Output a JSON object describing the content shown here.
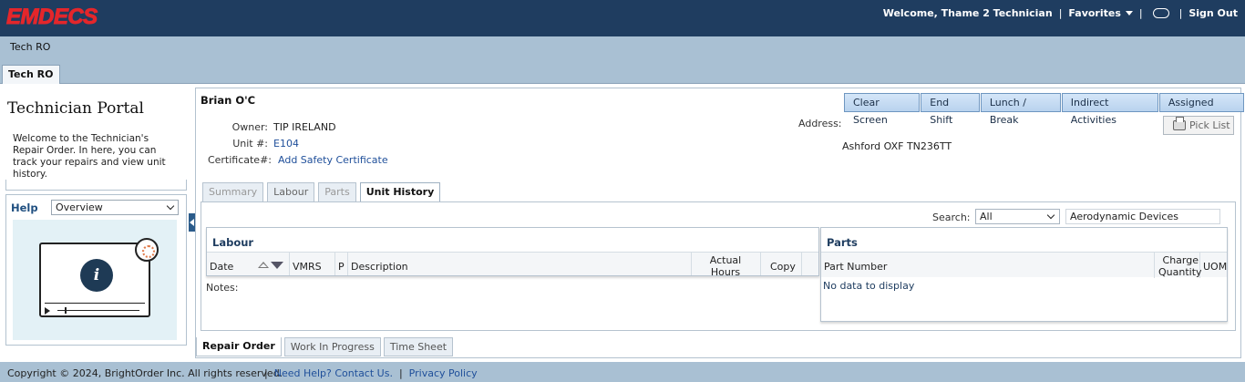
{
  "header": {
    "logo": "EMDECS",
    "welcome": "Welcome, Thame 2 Technician",
    "favorites": "Favorites",
    "sign_out": "Sign Out",
    "separator": "|"
  },
  "breadcrumb": "Tech RO",
  "top_tab": "Tech RO",
  "left": {
    "title": "Technician Portal",
    "description": "Welcome to the Technician's Repair Order. In here, you can track your repairs and view unit history.",
    "help_label": "Help",
    "help_select_value": "Overview"
  },
  "tech": {
    "name": "Brian O'C",
    "owner_label": "Owner:",
    "owner_value": "TIP IRELAND",
    "unit_label": "Unit #:",
    "unit_value": "E104",
    "cert_label": "Certificate#:",
    "cert_value": "Add Safety Certificate",
    "address_label": "Address:",
    "address_value": "Ashford OXF TN236TT"
  },
  "actions": {
    "clear_screen": "Clear Screen",
    "end_shift": "End Shift",
    "lunch_break": "Lunch / Break",
    "indirect": "Indirect Activities",
    "assigned": "Assigned Work",
    "pick_list": "Pick List"
  },
  "tabs": [
    "Summary",
    "Labour",
    "Parts",
    "Unit History"
  ],
  "search": {
    "label": "Search:",
    "select_value": "All",
    "input_value": "Aerodynamic Devices"
  },
  "labour": {
    "title": "Labour",
    "columns": [
      "Date",
      "VMRS",
      "P",
      "Description",
      "Actual Hours",
      "Copy"
    ],
    "notes_label": "Notes:"
  },
  "parts": {
    "title": "Parts",
    "columns": [
      "Part Number",
      "Charge Quantity",
      "UOM"
    ],
    "empty_text": "No data to display"
  },
  "bottom_tabs": [
    "Repair Order",
    "Work In Progress",
    "Time Sheet"
  ],
  "footer": {
    "copyright": "Copyright © 2024, BrightOrder Inc. All rights reserved.",
    "help": "Need Help? Contact Us.",
    "privacy": "Privacy Policy",
    "separator": "|"
  }
}
